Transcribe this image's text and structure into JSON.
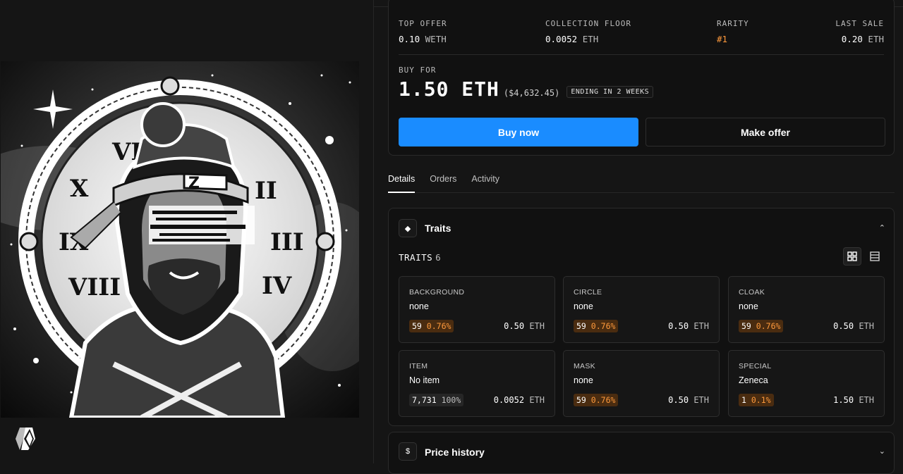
{
  "stats": [
    {
      "label": "TOP OFFER",
      "amount": "0.10",
      "currency": "WETH"
    },
    {
      "label": "COLLECTION FLOOR",
      "amount": "0.0052",
      "currency": "ETH"
    },
    {
      "label": "RARITY",
      "amount": "#1",
      "currency": ""
    },
    {
      "label": "LAST SALE",
      "amount": "0.20",
      "currency": "ETH"
    }
  ],
  "buy": {
    "label": "BUY FOR",
    "price": "1.50 ETH",
    "usd": "($4,632.45)",
    "ending": "ENDING IN 2 WEEKS",
    "buy_now": "Buy now",
    "make_offer": "Make offer"
  },
  "tabs": [
    "Details",
    "Orders",
    "Activity"
  ],
  "traits_section": {
    "title": "Traits",
    "count_label": "TRAITS",
    "count": "6",
    "items": [
      {
        "key": "BACKGROUND",
        "value": "none",
        "count": "59",
        "pct": "0.76%",
        "price": "0.50",
        "currency": "ETH"
      },
      {
        "key": "CIRCLE",
        "value": "none",
        "count": "59",
        "pct": "0.76%",
        "price": "0.50",
        "currency": "ETH"
      },
      {
        "key": "CLOAK",
        "value": "none",
        "count": "59",
        "pct": "0.76%",
        "price": "0.50",
        "currency": "ETH"
      },
      {
        "key": "ITEM",
        "value": "No item",
        "count": "7,731",
        "pct": "100%",
        "price": "0.0052",
        "currency": "ETH"
      },
      {
        "key": "MASK",
        "value": "none",
        "count": "59",
        "pct": "0.76%",
        "price": "0.50",
        "currency": "ETH"
      },
      {
        "key": "SPECIAL",
        "value": "Zeneca",
        "count": "1",
        "pct": "0.1%",
        "price": "1.50",
        "currency": "ETH"
      }
    ]
  },
  "price_history": {
    "title": "Price history",
    "icon": "dollar-icon"
  },
  "colors": {
    "accent": "#1a8cff",
    "rarity": "#ff9a3c",
    "badge_bg": "#4a2c10"
  }
}
